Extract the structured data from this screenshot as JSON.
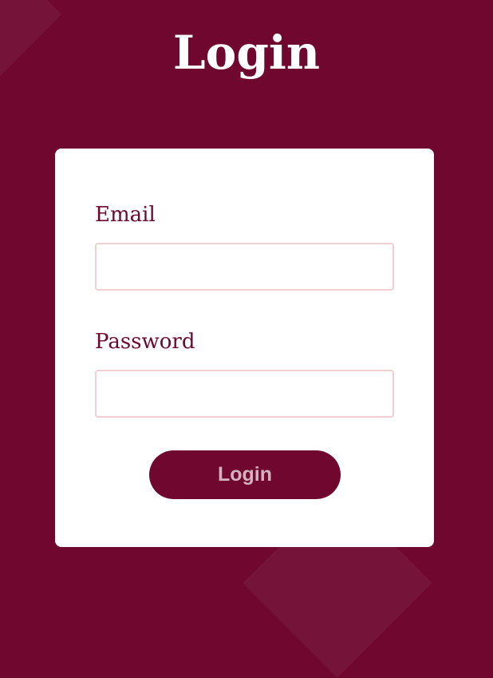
{
  "header": {
    "title": "Login"
  },
  "form": {
    "email_label": "Email",
    "email_value": "",
    "password_label": "Password",
    "password_value": "",
    "submit_label": "Login"
  },
  "colors": {
    "background": "#6f072f",
    "card": "#ffffff",
    "accent": "#6f072f",
    "input_border": "#f2cfd2",
    "button_text": "#d4b3bf"
  }
}
